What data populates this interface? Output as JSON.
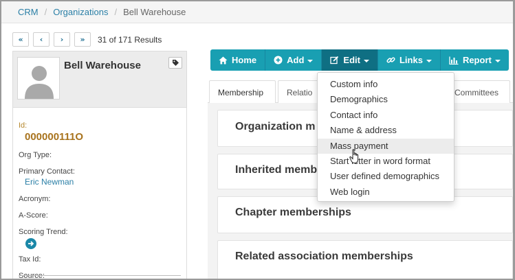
{
  "breadcrumb": {
    "items": [
      "CRM",
      "Organizations"
    ],
    "current": "Bell Warehouse"
  },
  "pager": {
    "first_icon": "double-chevron-left-icon",
    "prev_icon": "chevron-left-icon",
    "next_icon": "chevron-right-icon",
    "last_icon": "double-chevron-right-icon",
    "results_text": "31 of 171 Results"
  },
  "profile": {
    "name": "Bell Warehouse",
    "avatar_icon": "user-silhouette-icon",
    "tag_icon": "tag-icon",
    "id_label": "Id:",
    "id_value": "000000111O",
    "org_type_label": "Org Type:",
    "primary_contact_label": "Primary Contact:",
    "primary_contact_value": "Eric Newman",
    "acronym_label": "Acronym:",
    "a_score_label": "A-Score:",
    "scoring_trend_label": "Scoring Trend:",
    "scoring_trend_icon": "arrow-right-circle-icon",
    "tax_id_label": "Tax Id:",
    "source_label": "Source:"
  },
  "toolbar": {
    "home": "Home",
    "add": "Add",
    "edit": "Edit",
    "links": "Links",
    "report": "Report"
  },
  "tabs": [
    "Membership",
    "Relatio",
    "Committees"
  ],
  "panels": [
    "Organization m",
    "Inherited memb",
    "Chapter memberships",
    "Related association memberships"
  ],
  "edit_menu": {
    "items": [
      "Custom info",
      "Demographics",
      "Contact info",
      "Name & address",
      "Mass payment",
      "Start letter in word format",
      "User defined demographics",
      "Web login"
    ],
    "hovered": "Mass payment"
  },
  "colors": {
    "toolbar": "#199fb2",
    "toolbar_active": "#0f6f83",
    "link": "#2a7fa6",
    "id_value": "#a8731d"
  }
}
